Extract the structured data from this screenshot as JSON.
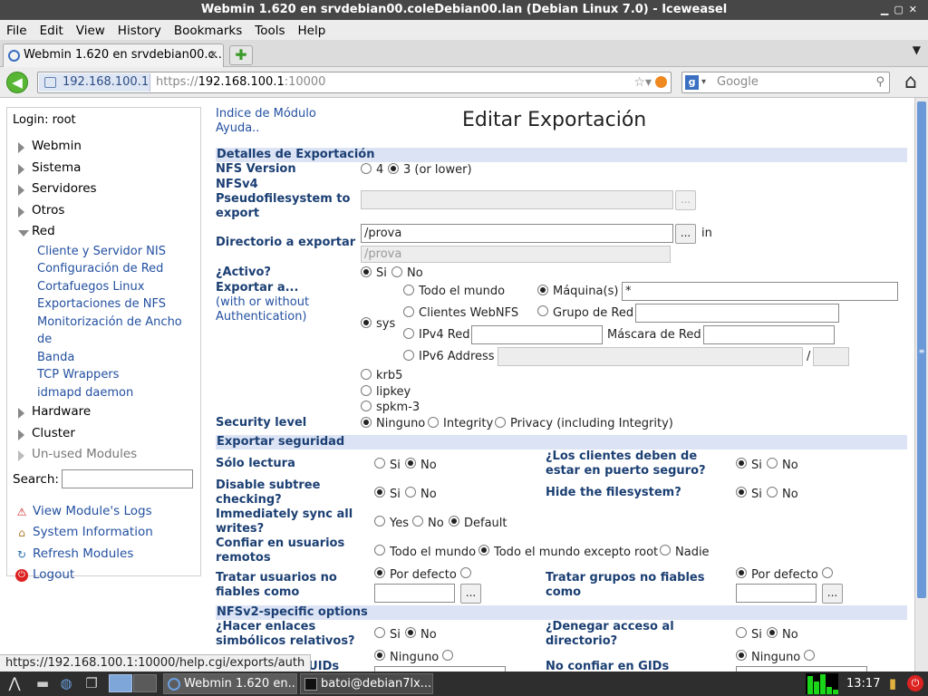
{
  "window": {
    "title": "Webmin 1.620 en srvdebian00.coleDebian00.lan (Debian Linux 7.0) - Iceweasel",
    "controls": [
      "▁",
      "▢",
      "✕"
    ]
  },
  "menu": [
    "File",
    "Edit",
    "View",
    "History",
    "Bookmarks",
    "Tools",
    "Help"
  ],
  "tab": {
    "title": "Webmin 1.620 en srvdebian00.c...",
    "close": "✕",
    "new": "✚"
  },
  "nav": {
    "identity": "192.168.100.1",
    "url_scheme": "https://",
    "url_host": "192.168.100.1",
    "url_port": ":10000",
    "search_placeholder": "Google",
    "search_engine": "g"
  },
  "left": {
    "login": "Login: root",
    "categories_top": [
      "Webmin",
      "Sistema",
      "Servidores",
      "Otros"
    ],
    "open_category": "Red",
    "red_items": [
      "Cliente y Servidor NIS",
      "Configuración de Red",
      "Cortafuegos Linux",
      "Exportaciones de NFS",
      "Monitorización de Ancho de",
      "Banda",
      "TCP Wrappers",
      "idmapd daemon"
    ],
    "categories_bottom": [
      "Hardware",
      "Cluster"
    ],
    "unused": "Un-used Modules",
    "search_label": "Search:",
    "links": [
      "View Module's Logs",
      "System Information",
      "Refresh Modules",
      "Logout"
    ]
  },
  "main": {
    "module_index": "Indice de Módulo",
    "help": "Ayuda..",
    "title": "Editar Exportación",
    "sections": {
      "details": "Detalles de Exportación",
      "security": "Exportar seguridad",
      "nfsv2": "NFSv2-specific options"
    },
    "nfs_version": {
      "label": "NFS Version",
      "opt4": "4",
      "opt3": "3 (or lower)",
      "selected": "3"
    },
    "pseudofs": {
      "label1": "NFSv4",
      "label2": "Pseudofilesystem to",
      "label3": "export",
      "value": ""
    },
    "directory": {
      "label": "Directorio a exportar",
      "value": "/prova",
      "in": "in",
      "preview": "/prova"
    },
    "active": {
      "label": "¿Activo?",
      "yes": "Si",
      "no": "No",
      "selected": "Si"
    },
    "export_to": {
      "label": "Exportar a...",
      "sub1": "(with or without",
      "sub2": "Authentication)",
      "sys": "sys",
      "krb5": "krb5",
      "lipkey": "lipkey",
      "spkm3": "spkm-3",
      "everyone": "Todo el mundo",
      "hosts": "Máquina(s)",
      "hosts_value": "*",
      "webnfs": "Clientes WebNFS",
      "netgroup": "Grupo de Red",
      "ipv4": "IPv4 Red",
      "netmask": "Máscara de Red",
      "ipv6": "IPv6 Address",
      "slash": "/"
    },
    "security_level": {
      "label": "Security level",
      "none": "Ninguno",
      "integrity": "Integrity",
      "privacy": "Privacy (including Integrity)"
    },
    "readonly": {
      "label": "Sólo lectura",
      "yes": "Si",
      "no": "No"
    },
    "secure_port": {
      "label1": "¿Los clientes deben de",
      "label2": "estar en puerto seguro?",
      "yes": "Si",
      "no": "No"
    },
    "subtree": {
      "label1": "Disable subtree",
      "label2": "checking?",
      "yes": "Si",
      "no": "No"
    },
    "hide_fs": {
      "label": "Hide the filesystem?",
      "yes": "Si",
      "no": "No"
    },
    "sync": {
      "label1": "Immediately sync all",
      "label2": "writes?",
      "yes": "Yes",
      "no": "No",
      "default": "Default"
    },
    "trust_remote": {
      "label1": "Confiar en usuarios",
      "label2": "remotos",
      "all": "Todo el mundo",
      "all_but_root": "Todo el mundo excepto root",
      "none": "Nadie"
    },
    "untrusted_users": {
      "label1": "Tratar usuarios no",
      "label2": "fiables como",
      "default": "Por defecto"
    },
    "untrusted_groups": {
      "label1": "Tratar grupos no fiables",
      "label2": "como",
      "default": "Por defecto"
    },
    "symlinks": {
      "label1": "¿Hacer enlaces",
      "label2": "simbólicos relativos?",
      "yes": "Si",
      "no": "No"
    },
    "deny_dir": {
      "label1": "¿Denegar acceso al",
      "label2": "directorio?",
      "yes": "Si",
      "no": "No"
    },
    "distrust_uids": {
      "label": "No confiar en UIDs",
      "none": "Ninguno"
    },
    "distrust_gids": {
      "label": "No confiar en GIDs",
      "none": "Ninguno"
    },
    "ellipsis": "..."
  },
  "status": "https://192.168.100.1:10000/help.cgi/exports/auth",
  "taskbar": {
    "tasks": [
      "Webmin 1.620 en...",
      "batoi@debian7lx..."
    ],
    "clock": "13:17"
  }
}
